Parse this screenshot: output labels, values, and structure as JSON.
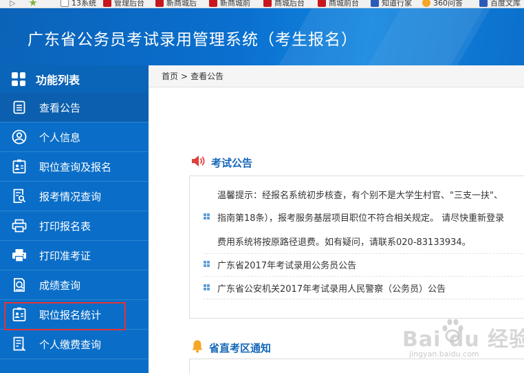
{
  "browser": {
    "bookmarks": [
      {
        "label": "13系统",
        "icon": "page-icon"
      },
      {
        "label": "管理后台",
        "icon": "site-icon"
      },
      {
        "label": "新商城后",
        "icon": "site-icon"
      },
      {
        "label": "新商城前",
        "icon": "site-icon"
      },
      {
        "label": "商城后台",
        "icon": "site-icon"
      },
      {
        "label": "商城前台",
        "icon": "site-icon"
      },
      {
        "label": "知道行家",
        "icon": "zhidao-icon"
      },
      {
        "label": "360问答",
        "icon": "360-icon"
      },
      {
        "label": "百度文库",
        "icon": "wenku-icon"
      }
    ]
  },
  "header": {
    "title": "广东省公务员考试录用管理系统（考生报名）"
  },
  "sidebar": {
    "heading": "功能列表",
    "items": [
      {
        "label": "查看公告",
        "icon": "notice-icon",
        "active": true
      },
      {
        "label": "个人信息",
        "icon": "user-icon"
      },
      {
        "label": "职位查询及报名",
        "icon": "id-card-icon"
      },
      {
        "label": "报考情况查询",
        "icon": "document-search-icon"
      },
      {
        "label": "打印报名表",
        "icon": "printer-icon"
      },
      {
        "label": "打印准考证",
        "icon": "printer-icon"
      },
      {
        "label": "成绩查询",
        "icon": "search-doc-icon"
      },
      {
        "label": "职位报名统计",
        "icon": "id-card-icon",
        "highlighted": true
      },
      {
        "label": "个人缴费查询",
        "icon": "document-list-icon"
      }
    ]
  },
  "breadcrumb": {
    "home": "首页",
    "separator": ">",
    "current": "查看公告"
  },
  "exam_notice": {
    "title": "考试公告",
    "tip_lines": [
      "温馨提示：经报名系统初步核查，有个别不是大学生村官、\"三支一扶\"、",
      "指南第18条），报考服务基层项目职位不符合相关规定。 请尽快重新登录",
      "费用系统将按原路径退费。如有疑问，请联系020-83133934。"
    ],
    "items": [
      "广东省2017年考试录用公务员公告",
      "广东省公安机关2017年考试录用人民警察（公务员）公告"
    ]
  },
  "region_notice": {
    "title": "省直考区通知"
  },
  "watermark": {
    "brand": "Bai du 经验",
    "url": "jingyan.baidu.com"
  },
  "colors": {
    "header_blue": "#0a6fcf",
    "sidebar_blue": "#0a6ec8",
    "active_item": "#0b5fae",
    "title_blue": "#1467b9",
    "highlight_red": "#e53333",
    "speaker_red": "#e0413b",
    "bell_orange": "#f5a623"
  }
}
